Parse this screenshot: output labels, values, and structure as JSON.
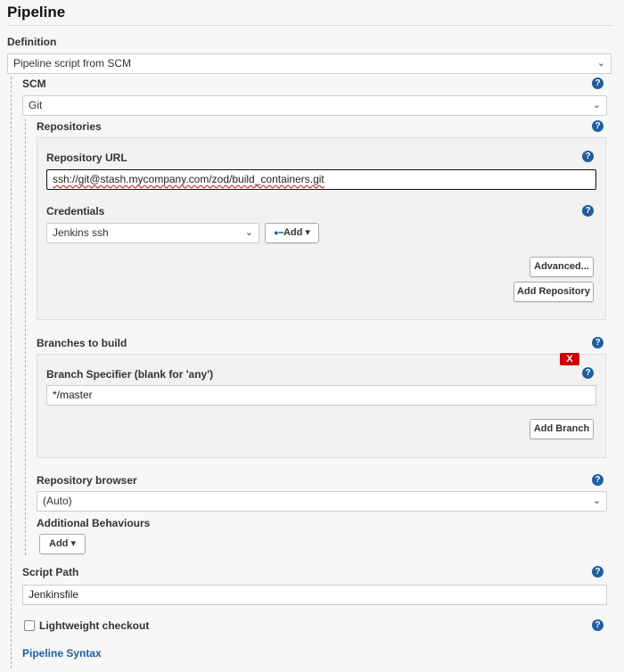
{
  "section_title": "Pipeline",
  "definition": {
    "label": "Definition",
    "selected": "Pipeline script from SCM"
  },
  "scm": {
    "label": "SCM",
    "selected": "Git"
  },
  "repositories": {
    "label": "Repositories",
    "url_label": "Repository URL",
    "url_value": "ssh://git@stash.mycompany.com/zod/build_containers.git",
    "credentials_label": "Credentials",
    "credentials_selected": "Jenkins ssh",
    "add_label": "Add",
    "advanced_label": "Advanced...",
    "add_repository_label": "Add Repository"
  },
  "branches": {
    "label": "Branches to build",
    "delete_label": "X",
    "specifier_label": "Branch Specifier (blank for 'any')",
    "specifier_value": "*/master",
    "add_branch_label": "Add Branch"
  },
  "repository_browser": {
    "label": "Repository browser",
    "selected": "(Auto)"
  },
  "additional_behaviours": {
    "label": "Additional Behaviours",
    "add_label": "Add"
  },
  "script_path": {
    "label": "Script Path",
    "value": "Jenkinsfile"
  },
  "lightweight_checkout": {
    "label": "Lightweight checkout",
    "checked": false
  },
  "pipeline_syntax_link": "Pipeline Syntax",
  "icons": {
    "help": "?",
    "chevron_down": "⌄",
    "caret": "▾",
    "key": "🔑"
  },
  "colors": {
    "link": "#1f5f9e",
    "help_icon": "#1f5f9e",
    "delete": "#cc0000"
  }
}
